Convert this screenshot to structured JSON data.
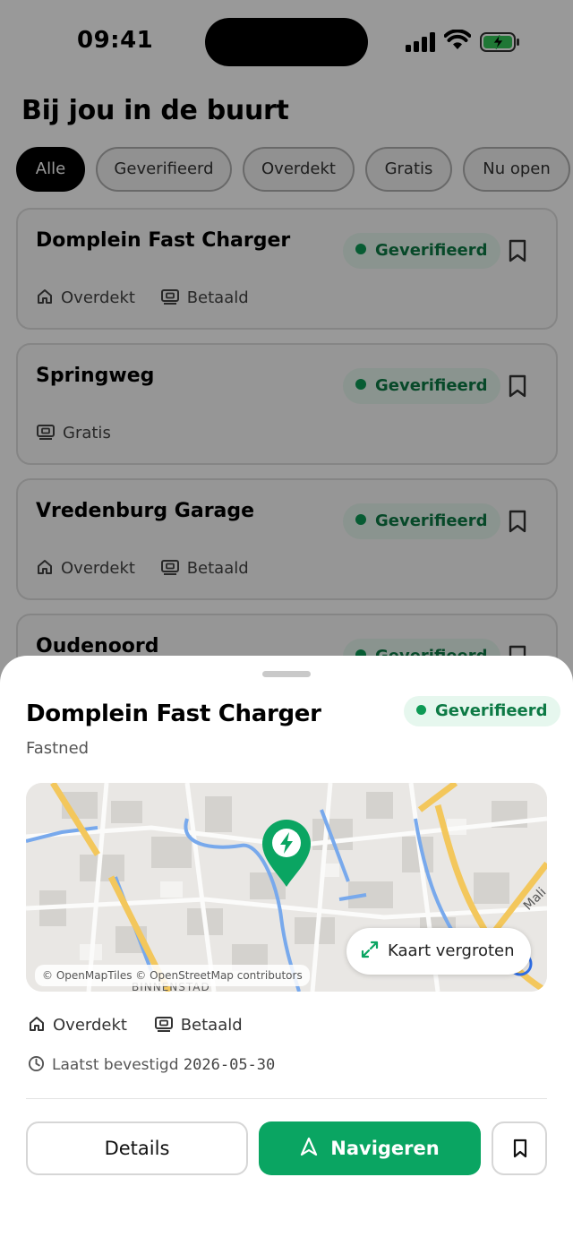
{
  "status_bar": {
    "time": "09:41"
  },
  "page": {
    "title": "Bij jou in de buurt"
  },
  "filters": [
    {
      "label": "Alle",
      "active": true
    },
    {
      "label": "Geverifieerd",
      "active": false
    },
    {
      "label": "Overdekt",
      "active": false
    },
    {
      "label": "Gratis",
      "active": false
    },
    {
      "label": "Nu open",
      "active": false
    }
  ],
  "list": [
    {
      "name": "Domplein Fast Charger",
      "badge": "Geverifieerd",
      "tags": [
        "Overdekt",
        "Betaald"
      ]
    },
    {
      "name": "Springweg",
      "badge": "Geverifieerd",
      "tags": [
        "Gratis"
      ]
    },
    {
      "name": "Vredenburg Garage",
      "badge": "Geverifieerd",
      "tags": [
        "Overdekt",
        "Betaald"
      ]
    },
    {
      "name": "Oudenoord",
      "badge": "Geverifieerd",
      "tags": []
    }
  ],
  "sheet": {
    "title": "Domplein Fast Charger",
    "operator": "Fastned",
    "badge": "Geverifieerd",
    "map": {
      "attribution": "© OpenMapTiles © OpenStreetMap contributors",
      "expand_label": "Kaart vergroten",
      "district_label": "BINNENSTAD",
      "street_label": "Mali"
    },
    "tags": {
      "covered": "Overdekt",
      "paid": "Betaald"
    },
    "confirmed_label": "Laatst bevestigd",
    "confirmed_date": "2026-05-30",
    "actions": {
      "details": "Details",
      "navigate": "Navigeren"
    }
  },
  "colors": {
    "brand_green": "#0aa562",
    "verified_text": "#0d7a45",
    "verified_bg": "#e6f7ee"
  },
  "icons": [
    "home-icon",
    "wallet-icon",
    "bookmark-icon",
    "expand-icon",
    "clock-icon",
    "navigation-arrow-icon",
    "charger-pin-icon"
  ]
}
